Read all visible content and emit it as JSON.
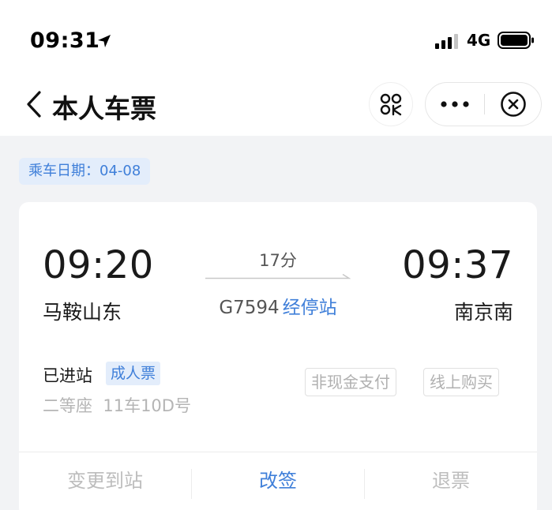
{
  "status_bar": {
    "time": "09:31",
    "network": "4G"
  },
  "nav": {
    "title": "本人车票"
  },
  "ticket": {
    "date_label": "乘车日期：04-08",
    "departure_time": "09:20",
    "departure_station": "马鞍山东",
    "arrival_time": "09:37",
    "arrival_station": "南京南",
    "duration": "17分",
    "train_number": "G7594",
    "stops_link": "经停站",
    "entry_status": "已进站",
    "ticket_type": "成人票",
    "seat_info": "二等座  11车10D号",
    "tags": [
      "非现金支付",
      "线上购买"
    ]
  },
  "actions": {
    "change_station": "变更到站",
    "reschedule": "改签",
    "refund": "退票"
  },
  "colors": {
    "accent": "#3f7fd9",
    "background": "#f2f3f5",
    "disabled_text": "#bdbdbd"
  }
}
